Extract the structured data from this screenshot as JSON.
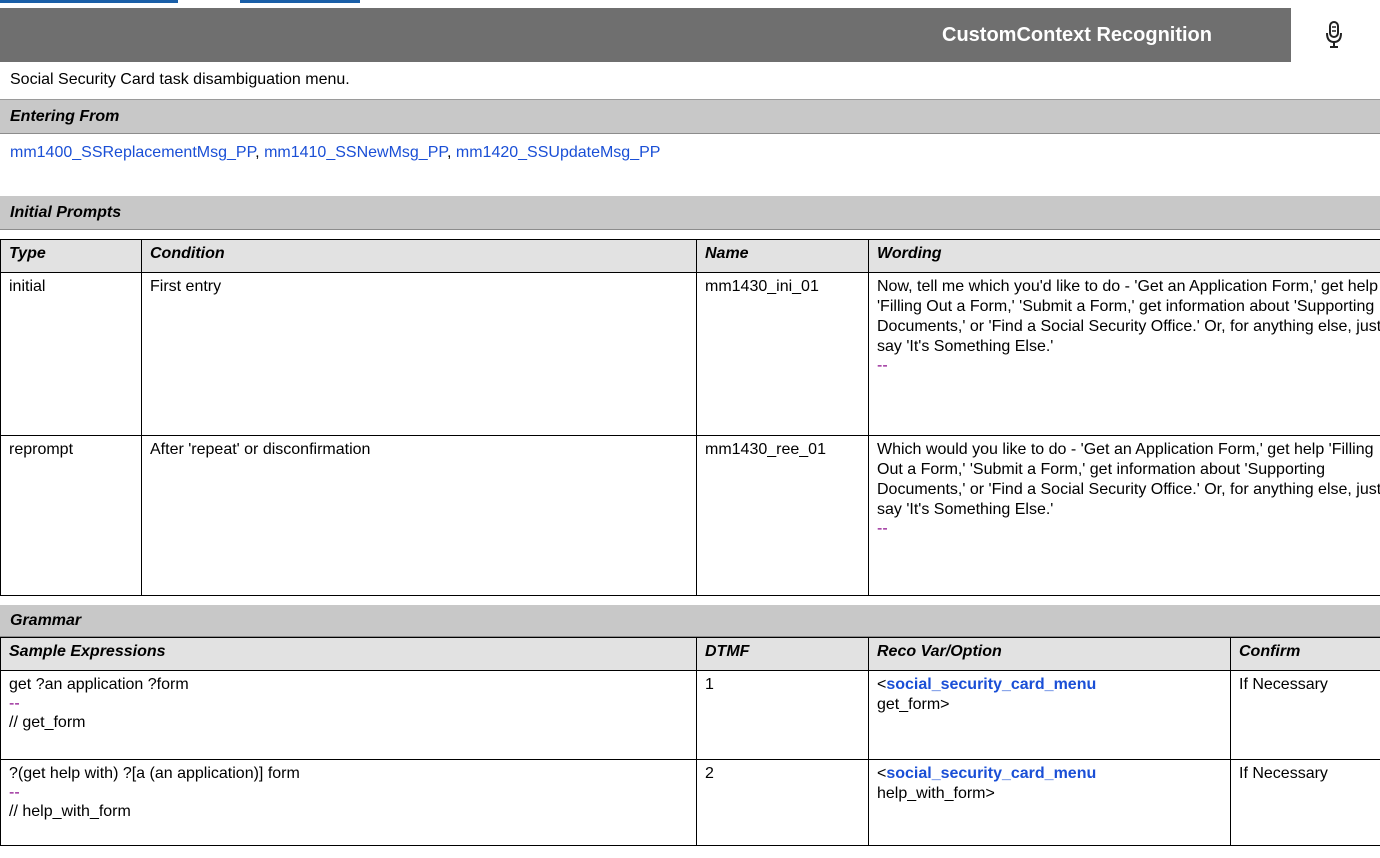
{
  "header": {
    "title": "CustomContext Recognition",
    "mic_icon": "microphone-icon"
  },
  "description": "Social Security Card task disambiguation menu.",
  "entering_from": {
    "heading": "Entering From",
    "links": [
      "mm1400_SSReplacementMsg_PP",
      "mm1410_SSNewMsg_PP",
      "mm1420_SSUpdateMsg_PP"
    ],
    "separator": ","
  },
  "initial_prompts": {
    "heading": "Initial Prompts",
    "columns": [
      "Type",
      "Condition",
      "Name",
      "Wording"
    ],
    "rows": [
      {
        "type": "initial",
        "condition": "First entry",
        "name": "mm1430_ini_01",
        "wording": "Now, tell me which you'd like to do - 'Get an Application Form,' get help 'Filling Out a Form,' 'Submit a Form,' get information about 'Supporting Documents,' or 'Find a Social Security Office.' Or, for anything else, just say 'It's Something Else.'",
        "dash": "--"
      },
      {
        "type": "reprompt",
        "condition": "After 'repeat' or disconfirmation",
        "name": "mm1430_ree_01",
        "wording": "Which would you like to do - 'Get an Application Form,' get help 'Filling Out a Form,' 'Submit a Form,' get information about 'Supporting Documents,' or 'Find a Social Security Office.' Or, for anything else, just say 'It's Something Else.'",
        "dash": "--"
      }
    ]
  },
  "grammar": {
    "heading": "Grammar",
    "columns": [
      "Sample Expressions",
      "DTMF",
      "Reco Var/Option",
      "Confirm"
    ],
    "rows": [
      {
        "expression": "get ?an application ?form",
        "dash": "--",
        "comment": "// get_form",
        "dtmf": "1",
        "reco_prefix": "<",
        "reco_var": "social_security_card_menu",
        "reco_option": "get_form>",
        "confirm": "If Necessary"
      },
      {
        "expression": "?(get help with) ?[a (an application)] form",
        "dash": "--",
        "comment": "// help_with_form",
        "dtmf": "2",
        "reco_prefix": "<",
        "reco_var": "social_security_card_menu",
        "reco_option": "help_with_form>",
        "confirm": "If Necessary"
      }
    ]
  }
}
